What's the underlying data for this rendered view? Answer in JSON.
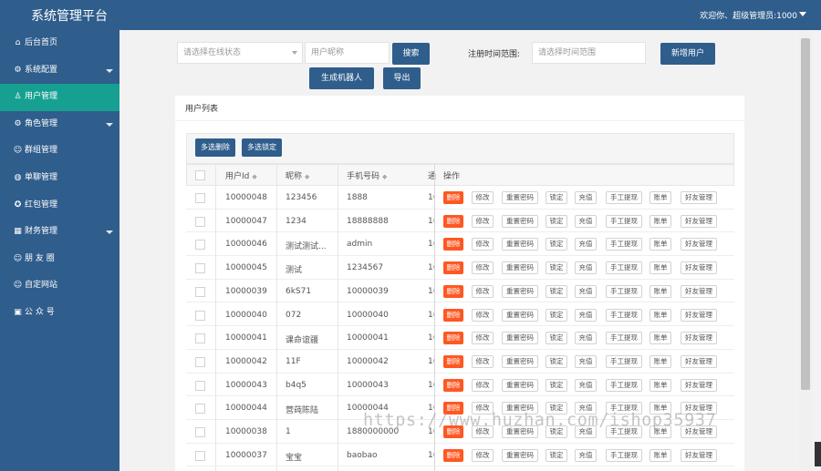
{
  "header": {
    "title": "系统管理平台",
    "user_greeting": "欢迎你、超级管理员:1000"
  },
  "sidebar": {
    "items": [
      {
        "label": "后台首页",
        "icon": "home-icon",
        "glyph": "⌂",
        "has_arrow": false,
        "active": false
      },
      {
        "label": "系统配置",
        "icon": "gear-icon",
        "glyph": "⚙",
        "has_arrow": true,
        "active": false
      },
      {
        "label": "用户管理",
        "icon": "user-icon",
        "glyph": "♙",
        "has_arrow": false,
        "active": true
      },
      {
        "label": "角色管理",
        "icon": "role-icon",
        "glyph": "⚙",
        "has_arrow": true,
        "active": false
      },
      {
        "label": "群组管理",
        "icon": "group-icon",
        "glyph": "☺",
        "has_arrow": false,
        "active": false
      },
      {
        "label": "单聊管理",
        "icon": "chat-icon",
        "glyph": "◍",
        "has_arrow": false,
        "active": false
      },
      {
        "label": "红包管理",
        "icon": "redpacket-icon",
        "glyph": "✪",
        "has_arrow": false,
        "active": false
      },
      {
        "label": "财务管理",
        "icon": "finance-icon",
        "glyph": "▦",
        "has_arrow": true,
        "active": false
      },
      {
        "label": "朋 友 圈",
        "icon": "moments-icon",
        "glyph": "☺",
        "has_arrow": false,
        "active": false
      },
      {
        "label": "自定网站",
        "icon": "website-icon",
        "glyph": "☺",
        "has_arrow": false,
        "active": false
      },
      {
        "label": "公 众 号",
        "icon": "public-account-icon",
        "glyph": "▣",
        "has_arrow": false,
        "active": false
      }
    ]
  },
  "filters": {
    "status_placeholder": "请选择在线状态",
    "nickname_placeholder": "用户昵称",
    "search_label": "搜索",
    "date_label": "注册时间范围:",
    "date_placeholder": "请选择时间范围",
    "add_user_label": "新增用户",
    "gen_robot_label": "生成机器人",
    "export_label": "导出"
  },
  "panel": {
    "title": "用户列表",
    "batch_delete_label": "多选删除",
    "batch_lock_label": "多选锁定"
  },
  "table": {
    "columns": [
      "用户Id",
      "昵称",
      "手机号码",
      "通",
      "操作"
    ],
    "actions": [
      "删除",
      "修改",
      "重置密码",
      "锁定",
      "充值",
      "手工提现",
      "账单",
      "好友管理"
    ],
    "rows": [
      {
        "id": "10000048",
        "nickname": "123456",
        "phone": "1888",
        "extra": "1("
      },
      {
        "id": "10000047",
        "nickname": "1234",
        "phone": "18888888",
        "extra": "1("
      },
      {
        "id": "10000046",
        "nickname": "测试测试...",
        "phone": "admin",
        "extra": "1("
      },
      {
        "id": "10000045",
        "nickname": "测试",
        "phone": "1234567",
        "extra": "1("
      },
      {
        "id": "10000039",
        "nickname": "6kS71",
        "phone": "10000039",
        "extra": "1("
      },
      {
        "id": "10000040",
        "nickname": "072",
        "phone": "10000040",
        "extra": "1("
      },
      {
        "id": "10000041",
        "nickname": "课命谊疆",
        "phone": "10000041",
        "extra": "1("
      },
      {
        "id": "10000042",
        "nickname": "11F",
        "phone": "10000042",
        "extra": "1("
      },
      {
        "id": "10000043",
        "nickname": "b4q5",
        "phone": "10000043",
        "extra": "1("
      },
      {
        "id": "10000044",
        "nickname": "营莼陈陆",
        "phone": "10000044",
        "extra": "1("
      },
      {
        "id": "10000038",
        "nickname": "1",
        "phone": "1880000000",
        "extra": "1("
      },
      {
        "id": "10000037",
        "nickname": "宝宝",
        "phone": "baobao",
        "extra": "1("
      }
    ]
  },
  "watermark": "https://www.huzhan.com/ishop35937",
  "colors": {
    "primary": "#2f5d8c",
    "active": "#16a092",
    "danger": "#ff5722"
  }
}
